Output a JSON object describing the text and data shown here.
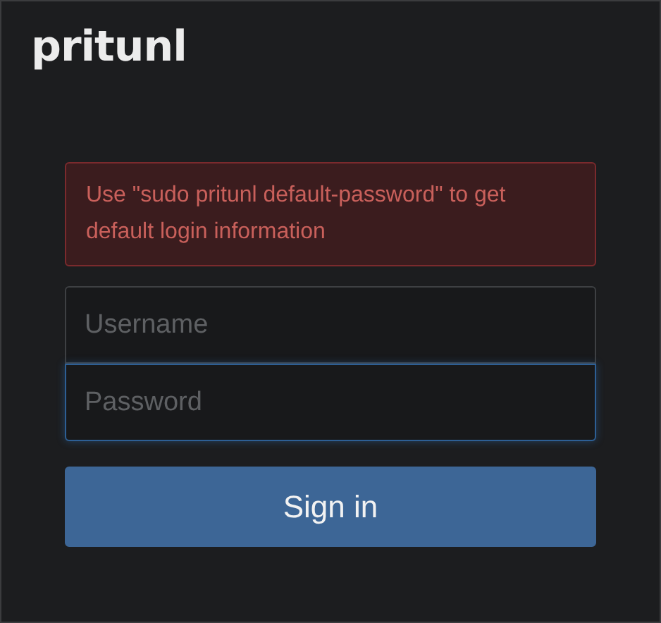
{
  "logo": {
    "text": "pritunl"
  },
  "alert": {
    "text": "Use \"sudo pritunl default-password\" to get default login information"
  },
  "fields": [
    {
      "placeholder": "Username",
      "focused": false
    },
    {
      "placeholder": "Password",
      "focused": true
    }
  ],
  "button": {
    "label": "Sign in"
  }
}
